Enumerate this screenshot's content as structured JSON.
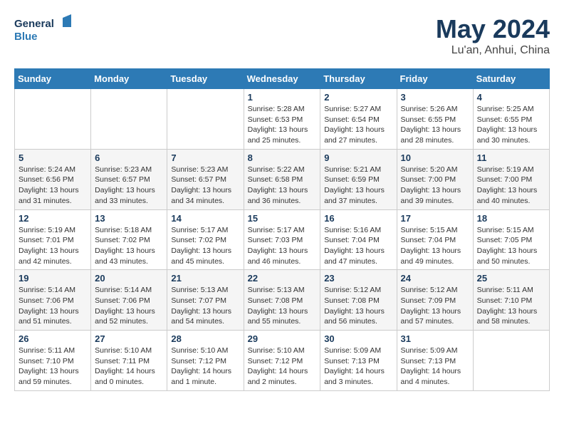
{
  "header": {
    "logo_line1": "General",
    "logo_line2": "Blue",
    "month_title": "May 2024",
    "location": "Lu'an, Anhui, China"
  },
  "weekdays": [
    "Sunday",
    "Monday",
    "Tuesday",
    "Wednesday",
    "Thursday",
    "Friday",
    "Saturday"
  ],
  "weeks": [
    [
      {
        "day": "",
        "info": ""
      },
      {
        "day": "",
        "info": ""
      },
      {
        "day": "",
        "info": ""
      },
      {
        "day": "1",
        "info": "Sunrise: 5:28 AM\nSunset: 6:53 PM\nDaylight: 13 hours\nand 25 minutes."
      },
      {
        "day": "2",
        "info": "Sunrise: 5:27 AM\nSunset: 6:54 PM\nDaylight: 13 hours\nand 27 minutes."
      },
      {
        "day": "3",
        "info": "Sunrise: 5:26 AM\nSunset: 6:55 PM\nDaylight: 13 hours\nand 28 minutes."
      },
      {
        "day": "4",
        "info": "Sunrise: 5:25 AM\nSunset: 6:55 PM\nDaylight: 13 hours\nand 30 minutes."
      }
    ],
    [
      {
        "day": "5",
        "info": "Sunrise: 5:24 AM\nSunset: 6:56 PM\nDaylight: 13 hours\nand 31 minutes."
      },
      {
        "day": "6",
        "info": "Sunrise: 5:23 AM\nSunset: 6:57 PM\nDaylight: 13 hours\nand 33 minutes."
      },
      {
        "day": "7",
        "info": "Sunrise: 5:23 AM\nSunset: 6:57 PM\nDaylight: 13 hours\nand 34 minutes."
      },
      {
        "day": "8",
        "info": "Sunrise: 5:22 AM\nSunset: 6:58 PM\nDaylight: 13 hours\nand 36 minutes."
      },
      {
        "day": "9",
        "info": "Sunrise: 5:21 AM\nSunset: 6:59 PM\nDaylight: 13 hours\nand 37 minutes."
      },
      {
        "day": "10",
        "info": "Sunrise: 5:20 AM\nSunset: 7:00 PM\nDaylight: 13 hours\nand 39 minutes."
      },
      {
        "day": "11",
        "info": "Sunrise: 5:19 AM\nSunset: 7:00 PM\nDaylight: 13 hours\nand 40 minutes."
      }
    ],
    [
      {
        "day": "12",
        "info": "Sunrise: 5:19 AM\nSunset: 7:01 PM\nDaylight: 13 hours\nand 42 minutes."
      },
      {
        "day": "13",
        "info": "Sunrise: 5:18 AM\nSunset: 7:02 PM\nDaylight: 13 hours\nand 43 minutes."
      },
      {
        "day": "14",
        "info": "Sunrise: 5:17 AM\nSunset: 7:02 PM\nDaylight: 13 hours\nand 45 minutes."
      },
      {
        "day": "15",
        "info": "Sunrise: 5:17 AM\nSunset: 7:03 PM\nDaylight: 13 hours\nand 46 minutes."
      },
      {
        "day": "16",
        "info": "Sunrise: 5:16 AM\nSunset: 7:04 PM\nDaylight: 13 hours\nand 47 minutes."
      },
      {
        "day": "17",
        "info": "Sunrise: 5:15 AM\nSunset: 7:04 PM\nDaylight: 13 hours\nand 49 minutes."
      },
      {
        "day": "18",
        "info": "Sunrise: 5:15 AM\nSunset: 7:05 PM\nDaylight: 13 hours\nand 50 minutes."
      }
    ],
    [
      {
        "day": "19",
        "info": "Sunrise: 5:14 AM\nSunset: 7:06 PM\nDaylight: 13 hours\nand 51 minutes."
      },
      {
        "day": "20",
        "info": "Sunrise: 5:14 AM\nSunset: 7:06 PM\nDaylight: 13 hours\nand 52 minutes."
      },
      {
        "day": "21",
        "info": "Sunrise: 5:13 AM\nSunset: 7:07 PM\nDaylight: 13 hours\nand 54 minutes."
      },
      {
        "day": "22",
        "info": "Sunrise: 5:13 AM\nSunset: 7:08 PM\nDaylight: 13 hours\nand 55 minutes."
      },
      {
        "day": "23",
        "info": "Sunrise: 5:12 AM\nSunset: 7:08 PM\nDaylight: 13 hours\nand 56 minutes."
      },
      {
        "day": "24",
        "info": "Sunrise: 5:12 AM\nSunset: 7:09 PM\nDaylight: 13 hours\nand 57 minutes."
      },
      {
        "day": "25",
        "info": "Sunrise: 5:11 AM\nSunset: 7:10 PM\nDaylight: 13 hours\nand 58 minutes."
      }
    ],
    [
      {
        "day": "26",
        "info": "Sunrise: 5:11 AM\nSunset: 7:10 PM\nDaylight: 13 hours\nand 59 minutes."
      },
      {
        "day": "27",
        "info": "Sunrise: 5:10 AM\nSunset: 7:11 PM\nDaylight: 14 hours\nand 0 minutes."
      },
      {
        "day": "28",
        "info": "Sunrise: 5:10 AM\nSunset: 7:12 PM\nDaylight: 14 hours\nand 1 minute."
      },
      {
        "day": "29",
        "info": "Sunrise: 5:10 AM\nSunset: 7:12 PM\nDaylight: 14 hours\nand 2 minutes."
      },
      {
        "day": "30",
        "info": "Sunrise: 5:09 AM\nSunset: 7:13 PM\nDaylight: 14 hours\nand 3 minutes."
      },
      {
        "day": "31",
        "info": "Sunrise: 5:09 AM\nSunset: 7:13 PM\nDaylight: 14 hours\nand 4 minutes."
      },
      {
        "day": "",
        "info": ""
      }
    ]
  ]
}
